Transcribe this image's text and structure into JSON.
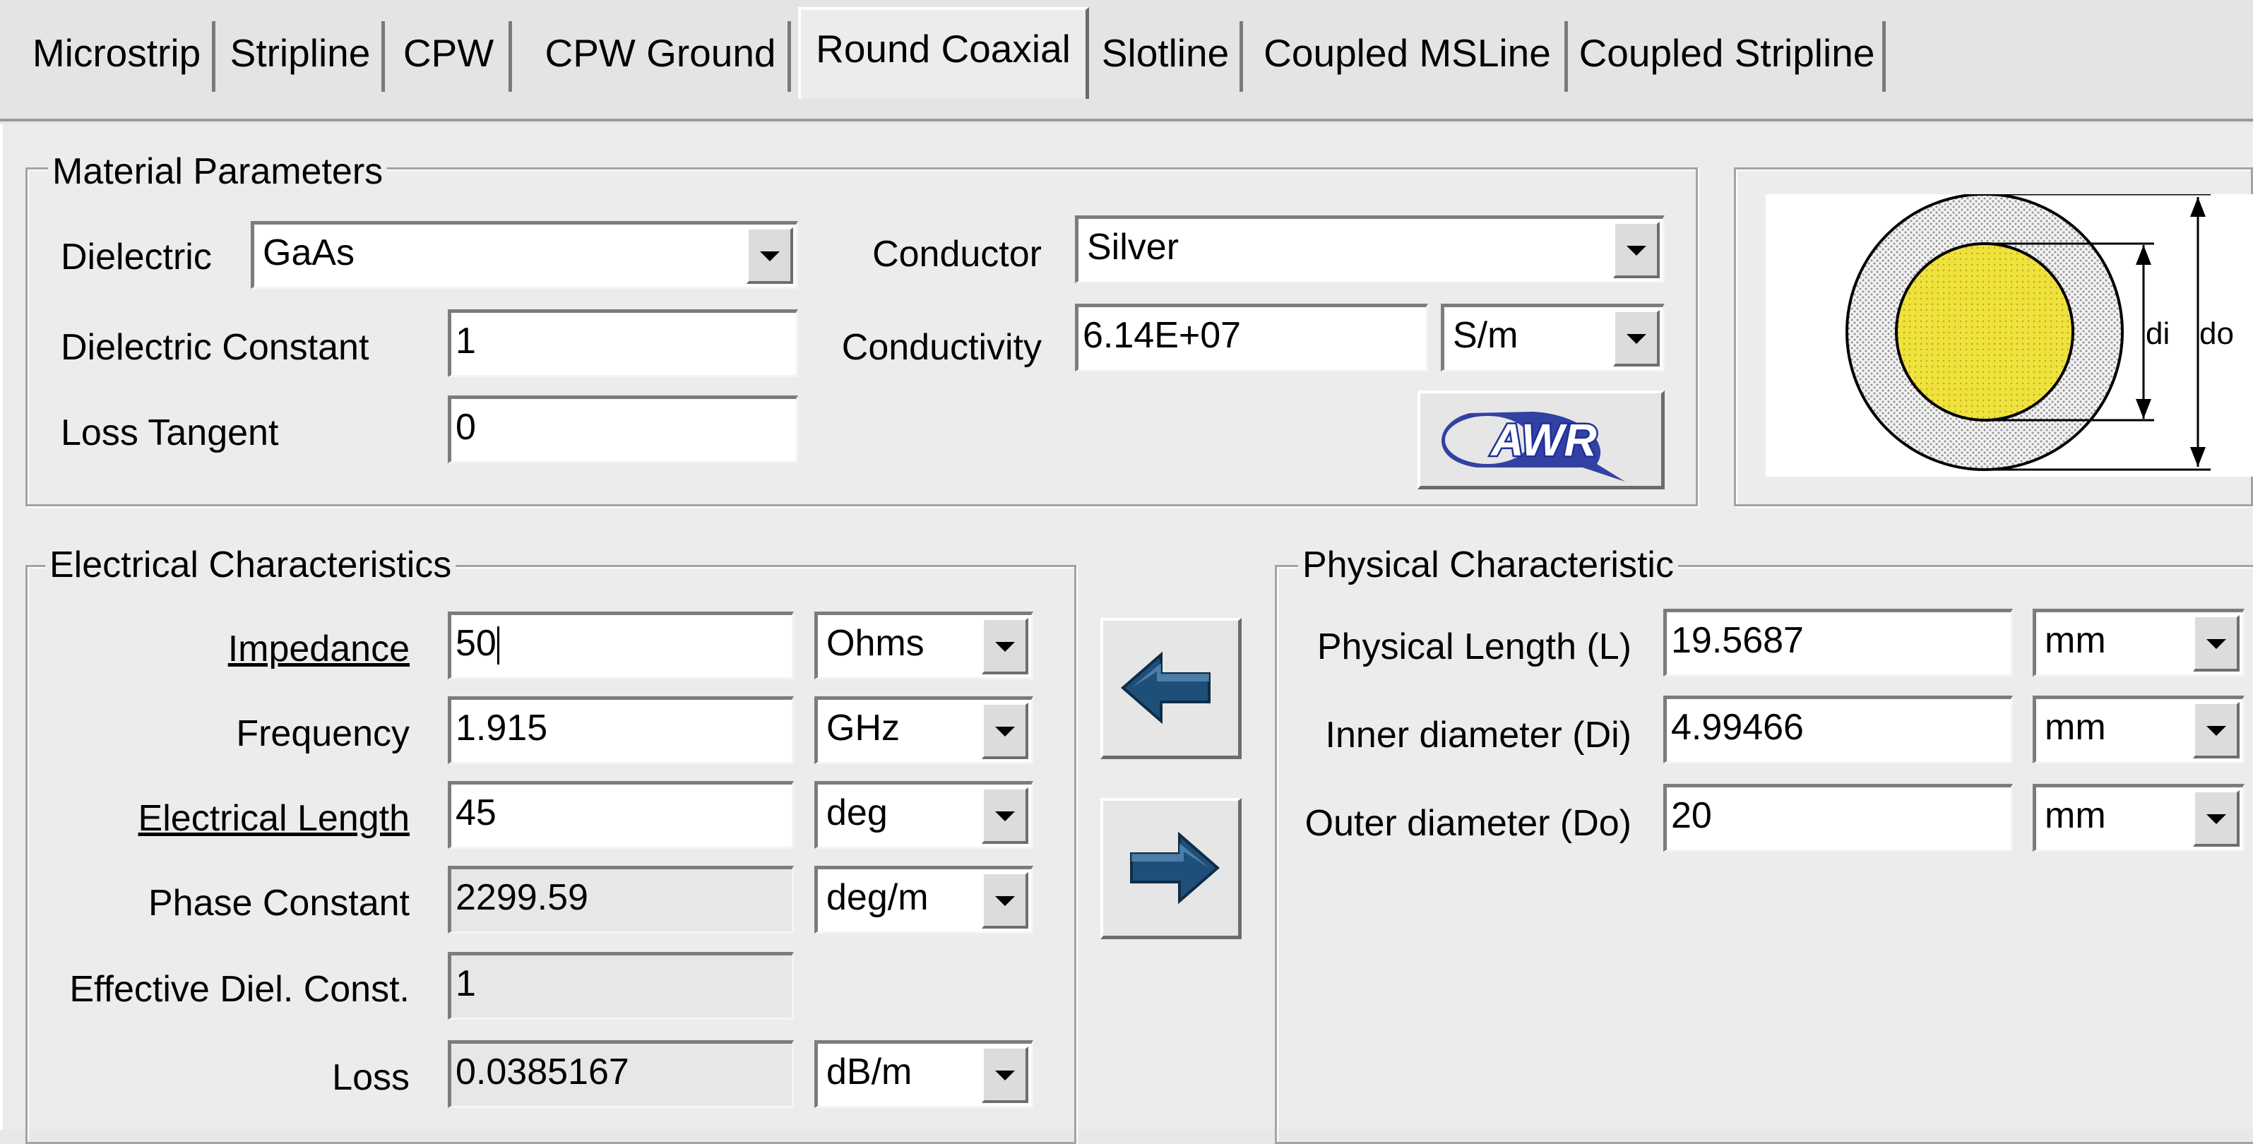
{
  "tabs": [
    {
      "label": "Microstrip"
    },
    {
      "label": "Stripline"
    },
    {
      "label": "CPW"
    },
    {
      "label": "CPW Ground"
    },
    {
      "label": "Round Coaxial"
    },
    {
      "label": "Slotline"
    },
    {
      "label": "Coupled MSLine"
    },
    {
      "label": "Coupled Stripline"
    }
  ],
  "material": {
    "title": "Material Parameters",
    "dielectric_label": "Dielectric",
    "dielectric_value": "GaAs",
    "dielectric_constant_label": "Dielectric Constant",
    "dielectric_constant_value": "1",
    "loss_tangent_label": "Loss Tangent",
    "loss_tangent_value": "0",
    "conductor_label": "Conductor",
    "conductor_value": "Silver",
    "conductivity_label": "Conductivity",
    "conductivity_value": "6.14E+07",
    "conductivity_unit": "S/m",
    "logo_text": "AWR"
  },
  "diagram": {
    "inner_label": "di",
    "outer_label": "do"
  },
  "electrical": {
    "title": "Electrical Characteristics",
    "impedance_label": "Impedance",
    "impedance_value": "50",
    "impedance_unit": "Ohms",
    "frequency_label": "Frequency",
    "frequency_value": "1.915",
    "frequency_unit": "GHz",
    "elec_length_label": "Electrical Length",
    "elec_length_value": "45",
    "elec_length_unit": "deg",
    "phase_label": "Phase Constant",
    "phase_value": "2299.59",
    "phase_unit": "deg/m",
    "eff_label": "Effective Diel. Const.",
    "eff_value": "1",
    "loss_label": "Loss",
    "loss_value": "0.0385167",
    "loss_unit": "dB/m"
  },
  "physical": {
    "title": "Physical Characteristic",
    "length_label": "Physical Length (L)",
    "length_value": "19.5687",
    "length_unit": "mm",
    "inner_label": "Inner diameter (Di)",
    "inner_value": "4.99466",
    "inner_unit": "mm",
    "outer_label": "Outer diameter (Do)",
    "outer_value": "20",
    "outer_unit": "mm"
  },
  "colors": {
    "arrow": "#1d4f79",
    "inner_conductor": "#f0e23c",
    "logo": "#1f2f9b"
  }
}
